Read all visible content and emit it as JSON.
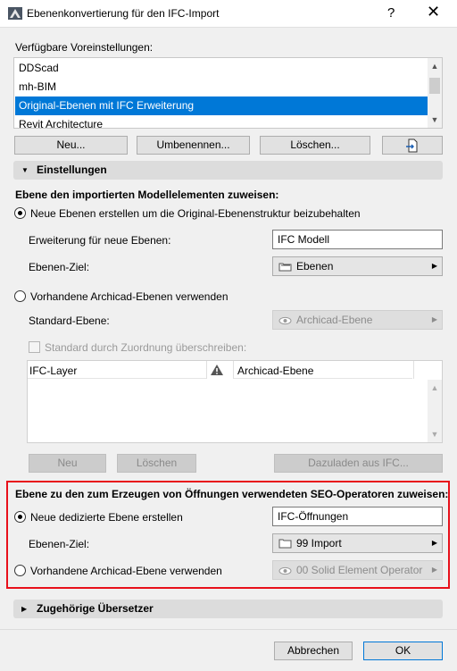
{
  "window": {
    "title": "Ebenenkonvertierung für den IFC-Import",
    "help": "?",
    "close": "✕"
  },
  "presets": {
    "label": "Verfügbare Voreinstellungen:",
    "items": [
      "DDScad",
      "mh-BIM",
      "Original-Ebenen mit IFC Erweiterung",
      "Revit Architecture"
    ],
    "selected_index": 2,
    "buttons": {
      "new": "Neu...",
      "rename": "Umbenennen...",
      "delete": "Löschen..."
    }
  },
  "settings": {
    "header": "Einstellungen",
    "assign_label": "Ebene den importierten Modellelementen zuweisen:",
    "radio_new_layers": "Neue Ebenen erstellen um die Original-Ebenenstruktur beizubehalten",
    "extension_label": "Erweiterung für neue Ebenen:",
    "extension_value": "IFC Modell",
    "target_label": "Ebenen-Ziel:",
    "target_value": "Ebenen",
    "radio_existing": "Vorhandene Archicad-Ebenen verwenden",
    "default_layer_label": "Standard-Ebene:",
    "default_layer_value": "Archicad-Ebene",
    "override_label": "Standard durch Zuordnung überschreiben:",
    "table": {
      "col1": "IFC-Layer",
      "col3": "Archicad-Ebene"
    },
    "table_buttons": {
      "new": "Neu",
      "delete": "Löschen",
      "load": "Dazuladen aus IFC..."
    }
  },
  "seo": {
    "label": "Ebene zu den zum Erzeugen von Öffnungen verwendeten SEO-Operatoren zuweisen:",
    "radio_new": "Neue dedizierte Ebene erstellen",
    "new_value": "IFC-Öffnungen",
    "target_label": "Ebenen-Ziel:",
    "target_value": "99 Import",
    "radio_existing": "Vorhandene Archicad-Ebene verwenden",
    "existing_value": "00 Solid Element Operator"
  },
  "translators": {
    "header": "Zugehörige Übersetzer"
  },
  "footer": {
    "cancel": "Abbrechen",
    "ok": "OK"
  },
  "colors": {
    "selection": "#0078d7",
    "highlight_border": "#e8101a",
    "section_bg": "#dcdcdc"
  }
}
